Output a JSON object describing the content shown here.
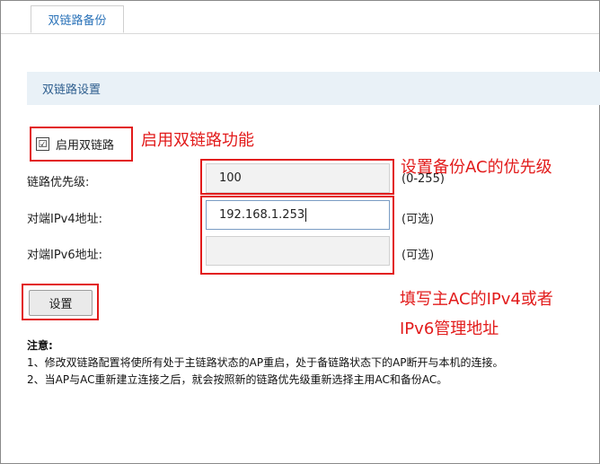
{
  "tab": {
    "label": "双链路备份"
  },
  "section": {
    "title": "双链路设置"
  },
  "form": {
    "enable_label": "启用双链路",
    "enable_checked_glyph": "☑",
    "priority_label": "链路优先级:",
    "priority_value": "100",
    "priority_hint": "(0-255)",
    "ipv4_label": "对端IPv4地址:",
    "ipv4_value": "192.168.1.253",
    "ipv4_hint": "(可选)",
    "ipv6_label": "对端IPv6地址:",
    "ipv6_value": "",
    "ipv6_hint": "(可选)",
    "save_label": "设置"
  },
  "annotations": {
    "enable": "启用双链路功能",
    "priority": "设置备份AC的优先级",
    "peer_line1": "填写主AC的IPv4或者",
    "peer_line2": "IPv6管理地址"
  },
  "notes": {
    "title": "注意:",
    "items": [
      "1、修改双链路配置将使所有处于主链路状态的AP重启，处于备链路状态下的AP断开与本机的连接。",
      "2、当AP与AC重新建立连接之后，就会按照新的链路优先级重新选择主用AC和备份AC。"
    ]
  },
  "colors": {
    "annotation": "#e21b1b",
    "tab_text": "#2b73b9",
    "section_bg": "#e9f1f7"
  }
}
